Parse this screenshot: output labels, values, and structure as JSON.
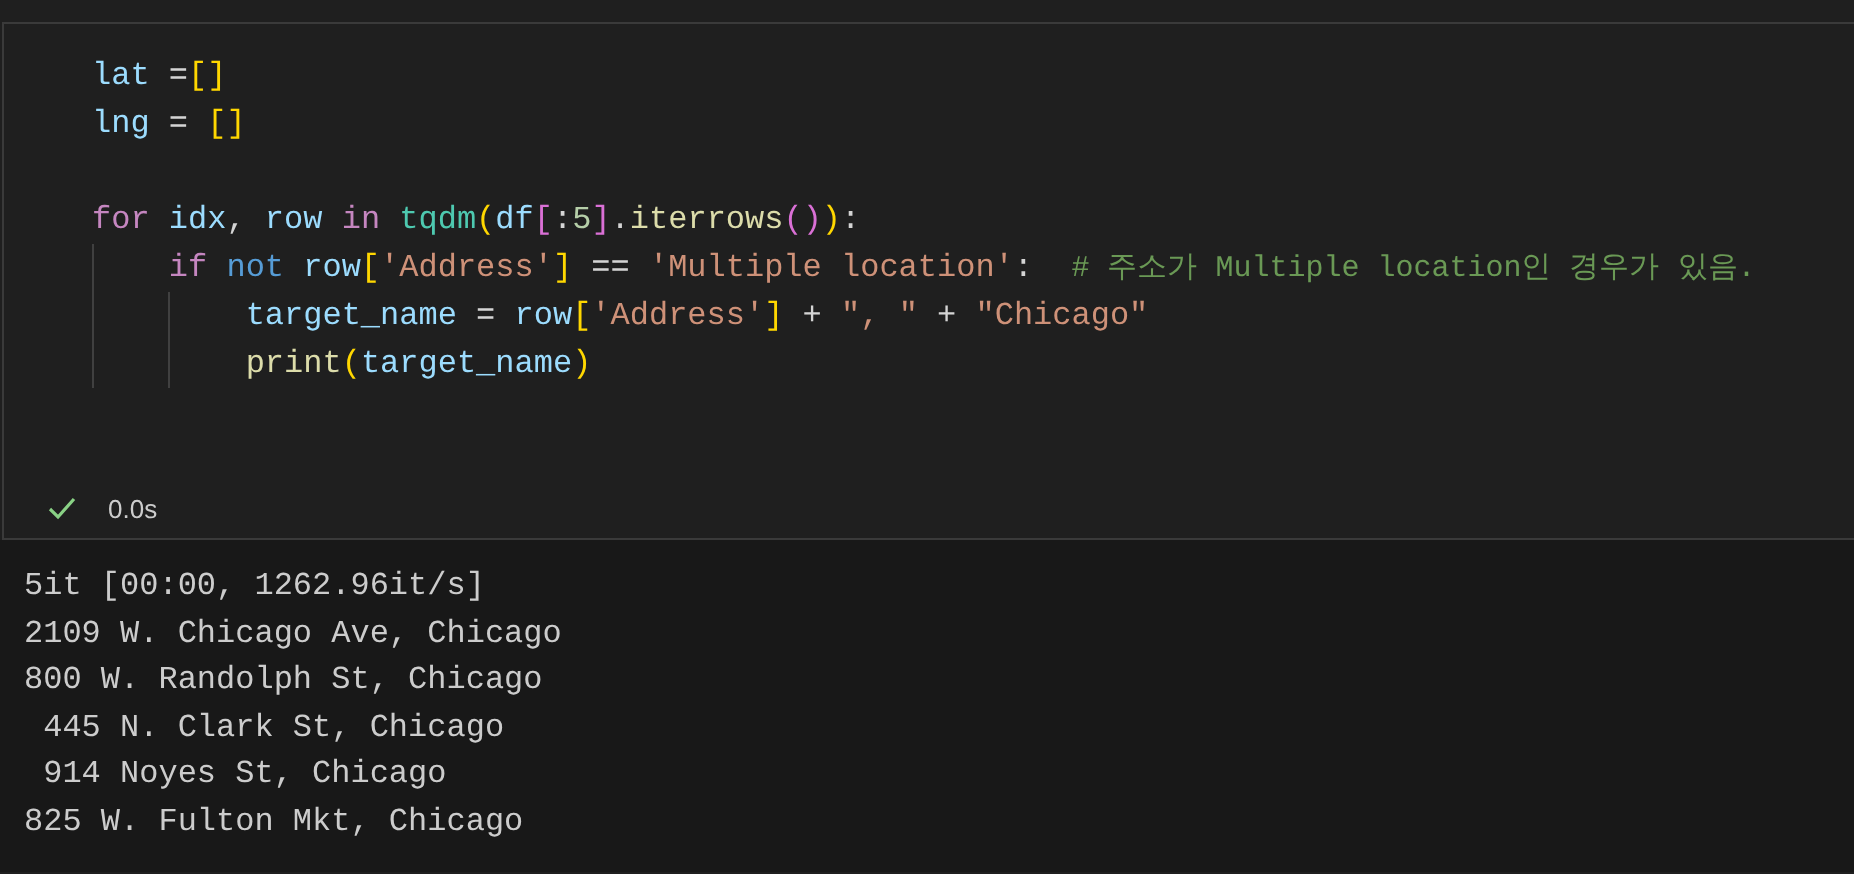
{
  "cell": {
    "code_lines": [
      {
        "kind": "code",
        "tokens": [
          {
            "kind": "var",
            "text": "lat"
          },
          {
            "kind": "op",
            "text": " ="
          },
          {
            "kind": "b1",
            "text": "[]"
          }
        ]
      },
      {
        "kind": "code",
        "tokens": [
          {
            "kind": "var",
            "text": "lng"
          },
          {
            "kind": "op",
            "text": " = "
          },
          {
            "kind": "b1",
            "text": "[]"
          }
        ]
      },
      {
        "kind": "blank"
      },
      {
        "kind": "code",
        "tokens": [
          {
            "kind": "kw",
            "text": "for"
          },
          {
            "kind": "var",
            "text": " idx"
          },
          {
            "kind": "op",
            "text": ", "
          },
          {
            "kind": "var",
            "text": "row"
          },
          {
            "kind": "kw",
            "text": " in "
          },
          {
            "kind": "cls",
            "text": "tqdm"
          },
          {
            "kind": "b1",
            "text": "("
          },
          {
            "kind": "var",
            "text": "df"
          },
          {
            "kind": "b2",
            "text": "["
          },
          {
            "kind": "op",
            "text": ":"
          },
          {
            "kind": "num",
            "text": "5"
          },
          {
            "kind": "b2",
            "text": "]"
          },
          {
            "kind": "op",
            "text": "."
          },
          {
            "kind": "fn",
            "text": "iterrows"
          },
          {
            "kind": "b2",
            "text": "()"
          },
          {
            "kind": "b1",
            "text": ")"
          },
          {
            "kind": "op",
            "text": ":"
          }
        ]
      },
      {
        "kind": "code",
        "tokens": [
          {
            "kind": "kw",
            "text": "    if"
          },
          {
            "kind": "kw2",
            "text": " not"
          },
          {
            "kind": "var",
            "text": " row"
          },
          {
            "kind": "b1",
            "text": "["
          },
          {
            "kind": "str",
            "text": "'Address'"
          },
          {
            "kind": "b1",
            "text": "]"
          },
          {
            "kind": "op",
            "text": " == "
          },
          {
            "kind": "str",
            "text": "'Multiple location'"
          },
          {
            "kind": "op",
            "text": ":  "
          },
          {
            "kind": "com",
            "text": "# 주소가 Multiple location인 경우가 있음."
          }
        ]
      },
      {
        "kind": "code",
        "tokens": [
          {
            "kind": "var",
            "text": "        target_name"
          },
          {
            "kind": "op",
            "text": " = "
          },
          {
            "kind": "var",
            "text": "row"
          },
          {
            "kind": "b1",
            "text": "["
          },
          {
            "kind": "str",
            "text": "'Address'"
          },
          {
            "kind": "b1",
            "text": "]"
          },
          {
            "kind": "op",
            "text": " + "
          },
          {
            "kind": "str",
            "text": "\", \""
          },
          {
            "kind": "op",
            "text": " + "
          },
          {
            "kind": "str",
            "text": "\"Chicago\""
          }
        ]
      },
      {
        "kind": "code",
        "tokens": [
          {
            "kind": "fn",
            "text": "        print"
          },
          {
            "kind": "b1",
            "text": "("
          },
          {
            "kind": "var",
            "text": "target_name"
          },
          {
            "kind": "b1",
            "text": ")"
          }
        ]
      }
    ],
    "status": {
      "succeeded": true,
      "duration": "0.0s"
    },
    "output_lines": [
      "5it [00:00, 1262.96it/s]",
      "2109 W. Chicago Ave, Chicago",
      "800 W. Randolph St, Chicago",
      " 445 N. Clark St, Chicago",
      " 914 Noyes St, Chicago",
      "825 W. Fulton Mkt, Chicago"
    ]
  }
}
